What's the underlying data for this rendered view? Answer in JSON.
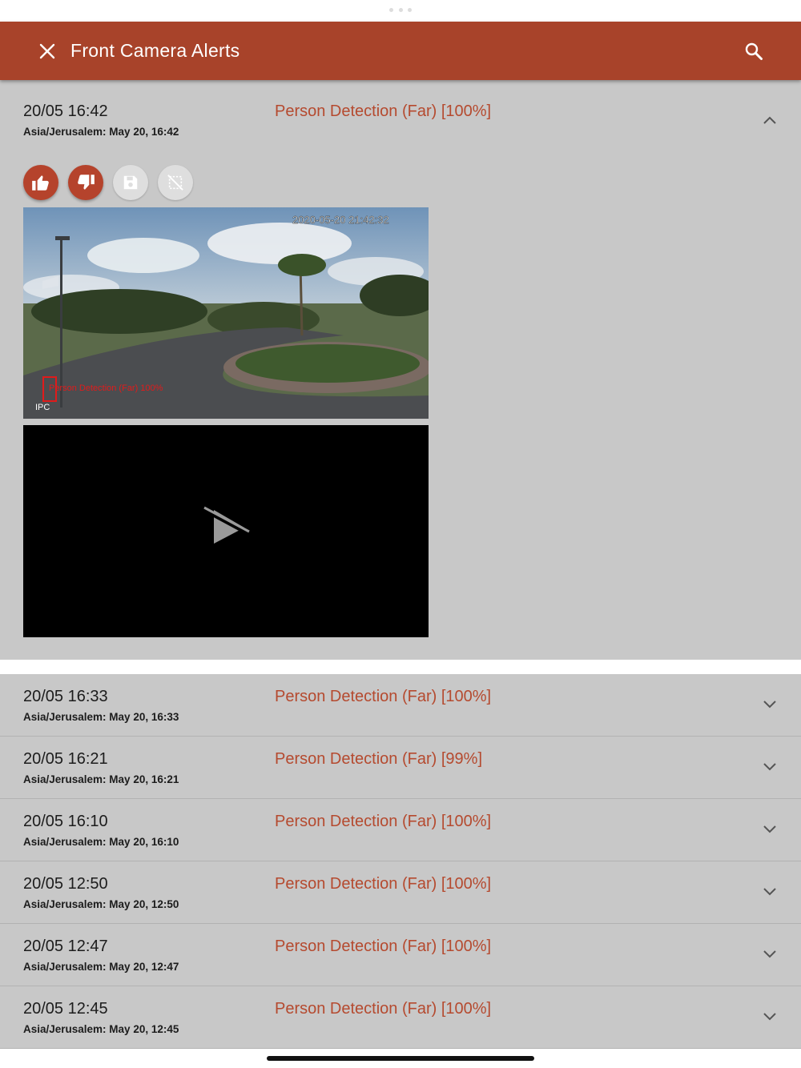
{
  "header": {
    "title": "Front Camera Alerts"
  },
  "colors": {
    "brand": "#a8432a",
    "alert_title": "#b54a2f",
    "row_bg": "#c8c8c8"
  },
  "expanded_alert": {
    "time": "20/05 16:42",
    "timezone_line": "Asia/Jerusalem: May 20, 16:42",
    "title": "Person Detection (Far) [100%]",
    "snapshot": {
      "timestamp_overlay": "2020-05-20 21:42:32",
      "detection_label": "Person Detection (Far) 100%",
      "watermark": "IPC"
    },
    "actions": [
      "thumbs-up-icon",
      "thumbs-down-icon",
      "save-icon",
      "no-selection-icon"
    ]
  },
  "alerts": [
    {
      "time": "20/05 16:33",
      "timezone_line": "Asia/Jerusalem: May 20, 16:33",
      "title": "Person Detection (Far) [100%]"
    },
    {
      "time": "20/05 16:21",
      "timezone_line": "Asia/Jerusalem: May 20, 16:21",
      "title": "Person Detection (Far) [99%]"
    },
    {
      "time": "20/05 16:10",
      "timezone_line": "Asia/Jerusalem: May 20, 16:10",
      "title": "Person Detection (Far) [100%]"
    },
    {
      "time": "20/05 12:50",
      "timezone_line": "Asia/Jerusalem: May 20, 12:50",
      "title": "Person Detection (Far) [100%]"
    },
    {
      "time": "20/05 12:47",
      "timezone_line": "Asia/Jerusalem: May 20, 12:47",
      "title": "Person Detection (Far) [100%]"
    },
    {
      "time": "20/05 12:45",
      "timezone_line": "Asia/Jerusalem: May 20, 12:45",
      "title": "Person Detection (Far) [100%]"
    }
  ]
}
